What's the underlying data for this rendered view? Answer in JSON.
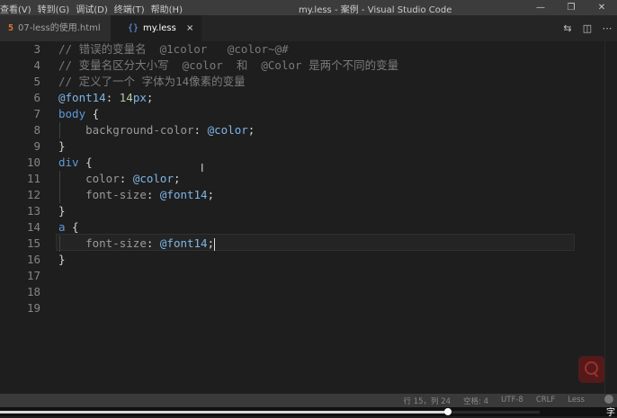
{
  "window": {
    "title": "my.less - 案例 - Visual Studio Code",
    "menu": [
      "查看(V)",
      "转到(G)",
      "调试(D)",
      "终端(T)",
      "帮助(H)"
    ],
    "controls": [
      "—",
      "❐",
      "✕"
    ]
  },
  "tabs": [
    {
      "icon": "5",
      "label": "07-less的使用.html",
      "active": false
    },
    {
      "icon": "{}",
      "label": "my.less",
      "active": true,
      "close": "×"
    }
  ],
  "editor": {
    "lines": [
      {
        "n": "3",
        "tokens": [
          {
            "t": "// 错误的变量名  @1color   @color~@#",
            "c": "com"
          }
        ]
      },
      {
        "n": "4",
        "tokens": [
          {
            "t": "// 变量名区分大小写  @color  和  @Color 是两个不同的变量",
            "c": "com"
          }
        ]
      },
      {
        "n": "5",
        "tokens": [
          {
            "t": "// 定义了一个 字体为14像素的变量",
            "c": "com"
          }
        ]
      },
      {
        "n": "6",
        "tokens": [
          {
            "t": "@font14",
            "c": "var"
          },
          {
            "t": ": ",
            "c": "text"
          },
          {
            "t": "14",
            "c": "num"
          },
          {
            "t": "px",
            "c": "var"
          },
          {
            "t": ";",
            "c": "text"
          }
        ]
      },
      {
        "n": "7",
        "tokens": [
          {
            "t": "body",
            "c": "key"
          },
          {
            "t": " {",
            "c": "text"
          }
        ]
      },
      {
        "n": "8",
        "tokens": [
          {
            "t": "    ",
            "c": "text"
          },
          {
            "t": "background-color",
            "c": "prop"
          },
          {
            "t": ": ",
            "c": "text"
          },
          {
            "t": "@color",
            "c": "var"
          },
          {
            "t": ";",
            "c": "text"
          }
        ]
      },
      {
        "n": "9",
        "tokens": [
          {
            "t": "}",
            "c": "text"
          }
        ]
      },
      {
        "n": "10",
        "tokens": [
          {
            "t": "div",
            "c": "key"
          },
          {
            "t": " {",
            "c": "text"
          }
        ]
      },
      {
        "n": "11",
        "tokens": [
          {
            "t": "    ",
            "c": "text"
          },
          {
            "t": "color",
            "c": "prop"
          },
          {
            "t": ": ",
            "c": "text"
          },
          {
            "t": "@color",
            "c": "var"
          },
          {
            "t": ";",
            "c": "text"
          }
        ]
      },
      {
        "n": "12",
        "tokens": [
          {
            "t": "    ",
            "c": "text"
          },
          {
            "t": "font-size",
            "c": "prop"
          },
          {
            "t": ": ",
            "c": "text"
          },
          {
            "t": "@font14",
            "c": "var"
          },
          {
            "t": ";",
            "c": "text"
          }
        ]
      },
      {
        "n": "13",
        "tokens": [
          {
            "t": "}",
            "c": "text"
          }
        ]
      },
      {
        "n": "14",
        "tokens": [
          {
            "t": "a",
            "c": "key"
          },
          {
            "t": " {",
            "c": "text"
          }
        ]
      },
      {
        "n": "15",
        "tokens": [
          {
            "t": "    ",
            "c": "text"
          },
          {
            "t": "font-size",
            "c": "prop"
          },
          {
            "t": ": ",
            "c": "text"
          },
          {
            "t": "@font14",
            "c": "var"
          },
          {
            "t": ";",
            "c": "text"
          }
        ],
        "cursor": true
      },
      {
        "n": "16",
        "tokens": [
          {
            "t": "}",
            "c": "text"
          }
        ]
      },
      {
        "n": "17",
        "tokens": []
      },
      {
        "n": "18",
        "tokens": []
      },
      {
        "n": "19",
        "tokens": []
      }
    ]
  },
  "statusbar": {
    "position": "行 15，列 24",
    "spaces": "空格: 4",
    "encoding": "UTF-8",
    "eol": "CRLF",
    "language": "Less"
  },
  "player": {
    "progress": 0.83,
    "glyph": "字"
  },
  "colors": {
    "accent": "#007acc",
    "variable": "#7eb6e6",
    "keyword": "#5c9ad6",
    "comment": "#7a7a7a"
  }
}
